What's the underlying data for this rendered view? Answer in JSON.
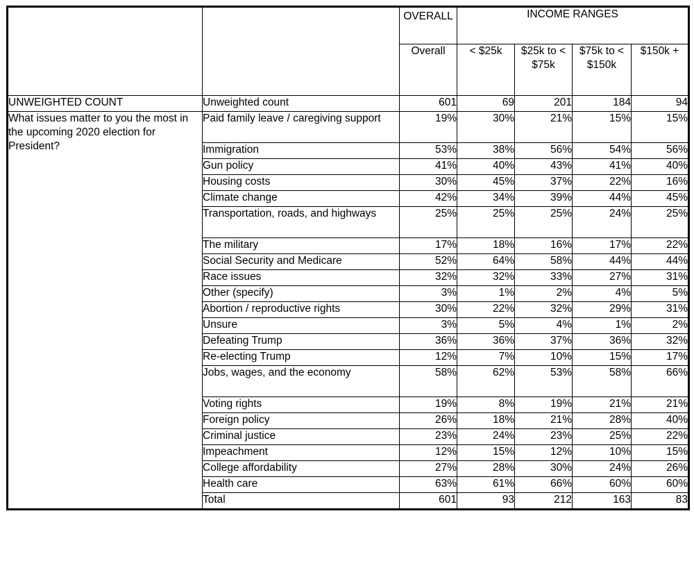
{
  "table": {
    "header": {
      "corner_blank": "",
      "overall_group": "OVERALL",
      "income_group": "INCOME RANGES",
      "subheaders": {
        "label_blank": "",
        "overall": "Overall",
        "lt25k": "< $25k",
        "k25_75": "$25k to < $75k",
        "k75_150": "$75k to < $150k",
        "gte150k": "$150k +"
      }
    },
    "section_unweighted": {
      "row_header": "UNWEIGHTED COUNT",
      "label": "Unweighted count",
      "values": [
        "601",
        "69",
        "201",
        "184",
        "94"
      ]
    },
    "question": "What issues matter to you the most in the upcoming 2020 election for President?",
    "rows": [
      {
        "label": "Paid family leave / caregiving support",
        "tall": true,
        "values": [
          "19%",
          "30%",
          "21%",
          "15%",
          "15%"
        ]
      },
      {
        "label": "Immigration",
        "tall": false,
        "values": [
          "53%",
          "38%",
          "56%",
          "54%",
          "56%"
        ]
      },
      {
        "label": "Gun policy",
        "tall": false,
        "values": [
          "41%",
          "40%",
          "43%",
          "41%",
          "40%"
        ]
      },
      {
        "label": "Housing costs",
        "tall": false,
        "values": [
          "30%",
          "45%",
          "37%",
          "22%",
          "16%"
        ]
      },
      {
        "label": "Climate change",
        "tall": false,
        "values": [
          "42%",
          "34%",
          "39%",
          "44%",
          "45%"
        ]
      },
      {
        "label": "Transportation, roads, and highways",
        "tall": true,
        "values": [
          "25%",
          "25%",
          "25%",
          "24%",
          "25%"
        ]
      },
      {
        "label": "The military",
        "tall": false,
        "values": [
          "17%",
          "18%",
          "16%",
          "17%",
          "22%"
        ]
      },
      {
        "label": "Social Security and Medicare",
        "tall": false,
        "values": [
          "52%",
          "64%",
          "58%",
          "44%",
          "44%"
        ]
      },
      {
        "label": "Race issues",
        "tall": false,
        "values": [
          "32%",
          "32%",
          "33%",
          "27%",
          "31%"
        ]
      },
      {
        "label": "Other (specify)",
        "tall": false,
        "values": [
          "3%",
          "1%",
          "2%",
          "4%",
          "5%"
        ]
      },
      {
        "label": "Abortion / reproductive rights",
        "tall": false,
        "values": [
          "30%",
          "22%",
          "32%",
          "29%",
          "31%"
        ]
      },
      {
        "label": "Unsure",
        "tall": false,
        "values": [
          "3%",
          "5%",
          "4%",
          "1%",
          "2%"
        ]
      },
      {
        "label": "Defeating Trump",
        "tall": false,
        "values": [
          "36%",
          "36%",
          "37%",
          "36%",
          "32%"
        ]
      },
      {
        "label": "Re-electing Trump",
        "tall": false,
        "values": [
          "12%",
          "7%",
          "10%",
          "15%",
          "17%"
        ]
      },
      {
        "label": "Jobs, wages, and the economy",
        "tall": true,
        "values": [
          "58%",
          "62%",
          "53%",
          "58%",
          "66%"
        ]
      },
      {
        "label": "Voting rights",
        "tall": false,
        "values": [
          "19%",
          "8%",
          "19%",
          "21%",
          "21%"
        ]
      },
      {
        "label": "Foreign policy",
        "tall": false,
        "values": [
          "26%",
          "18%",
          "21%",
          "28%",
          "40%"
        ]
      },
      {
        "label": "Criminal justice",
        "tall": false,
        "values": [
          "23%",
          "24%",
          "23%",
          "25%",
          "22%"
        ]
      },
      {
        "label": "Impeachment",
        "tall": false,
        "values": [
          "12%",
          "15%",
          "12%",
          "10%",
          "15%"
        ]
      },
      {
        "label": "College affordability",
        "tall": false,
        "values": [
          "27%",
          "28%",
          "30%",
          "24%",
          "26%"
        ]
      },
      {
        "label": "Health care",
        "tall": false,
        "values": [
          "63%",
          "61%",
          "66%",
          "60%",
          "60%"
        ]
      },
      {
        "label": "Total",
        "tall": false,
        "values": [
          "601",
          "93",
          "212",
          "163",
          "83"
        ]
      }
    ]
  }
}
